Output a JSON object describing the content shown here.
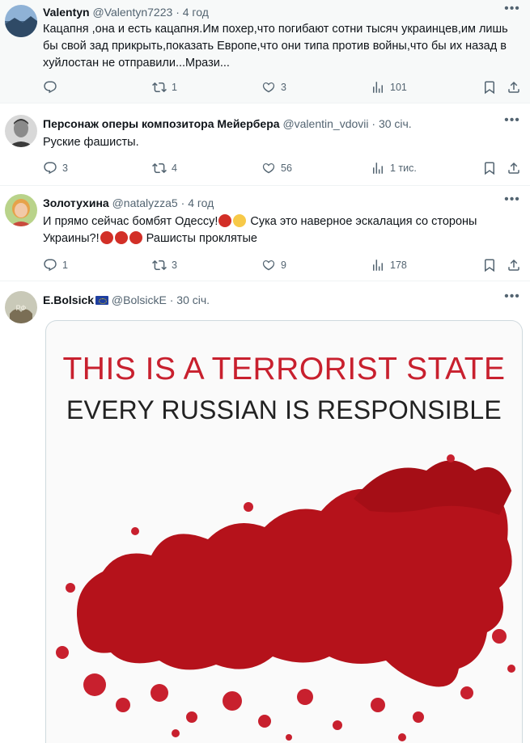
{
  "tweets": [
    {
      "name": "Valentyn",
      "handle": "@Valentyn7223",
      "time": "4 год",
      "text": "Кацапня ,она и есть кацапня.Им похер,что погибают сотни тысяч украинцев,им лишь бы свой зад прикрыть,показать Европе,что они типа против войны,что бы их назад в хуйлостан не отправили...Мрази...",
      "replies": "",
      "retweets": "1",
      "likes": "3",
      "views": "101"
    },
    {
      "name": "Персонаж оперы композитора Мейербера",
      "handle": "@valentin_vdovii",
      "time": "30 січ.",
      "text": "Руские фашисты.",
      "replies": "3",
      "retweets": "4",
      "likes": "56",
      "views": "1 тис."
    },
    {
      "name": "Золотухина",
      "handle": "@natalyzza5",
      "time": "4 год",
      "text_part1": "И прямо сейчас бомбят Одессу!",
      "text_part2": " Сука это наверное эскалация со стороны Украины?!",
      "text_part3": " Рашисты проклятые",
      "replies": "1",
      "retweets": "3",
      "likes": "9",
      "views": "178"
    },
    {
      "name": "E.Bolsick",
      "handle": "@BolsickE",
      "time": "30 січ.",
      "avatar_text": "РФ",
      "media_line1": "THIS IS A TERRORIST STATE",
      "media_line2": "EVERY RUSSIAN IS RESPONSIBLE"
    }
  ],
  "separator": "·",
  "colors": {
    "text": "#0f1419",
    "secondary": "#536471",
    "media_red": "#c8202e",
    "blood": "#b5121b"
  },
  "icons": [
    "reply-icon",
    "retweet-icon",
    "like-icon",
    "views-icon",
    "bookmark-icon",
    "share-icon",
    "more-icon"
  ]
}
